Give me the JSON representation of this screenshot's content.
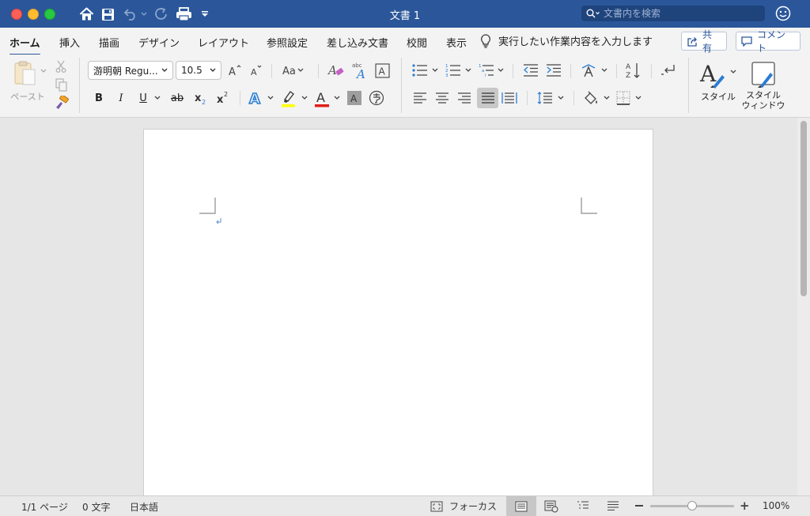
{
  "window": {
    "title": "文書 1",
    "search_placeholder": "文書内を検索"
  },
  "tabs": [
    "ホーム",
    "挿入",
    "描画",
    "デザイン",
    "レイアウト",
    "参照設定",
    "差し込み文書",
    "校閲",
    "表示"
  ],
  "active_tab": "ホーム",
  "tell_me": "実行したい作業内容を入力します",
  "share_label": "共有",
  "comment_label": "コメント",
  "clipboard": {
    "paste_label": "ペースト"
  },
  "font": {
    "name": "游明朝 Regu...",
    "size": "10.5",
    "highlight_color": "#ffff00",
    "font_color": "#e0201b"
  },
  "styles": {
    "styles_label": "スタイル",
    "pane_label_line1": "スタイル",
    "pane_label_line2": "ウィンドウ"
  },
  "status": {
    "page": "1/1 ページ",
    "words": "0 文字",
    "language": "日本語",
    "focus": "フォーカス",
    "zoom": "100%",
    "zoom_value": 0.5
  },
  "colors": {
    "titlebar": "#2b579a",
    "accent": "#2b579a",
    "ribbon": "#f3f3f3"
  }
}
